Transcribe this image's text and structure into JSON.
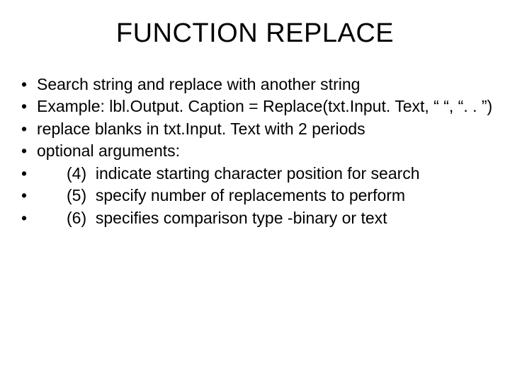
{
  "title": "FUNCTION REPLACE",
  "bullets": {
    "b1": "Search string and replace with another string",
    "b2": "Example: lbl.Output. Caption = Replace(txt.Input. Text, “ “, “. . ”)",
    "b3": "replace blanks in txt.Input. Text with 2 periods",
    "b4": "optional arguments:",
    "sub": {
      "s1": "(4)  indicate starting character position for search",
      "s2": "(5)  specify number of replacements to perform",
      "s3": "(6)  specifies comparison type -binary or text"
    }
  }
}
